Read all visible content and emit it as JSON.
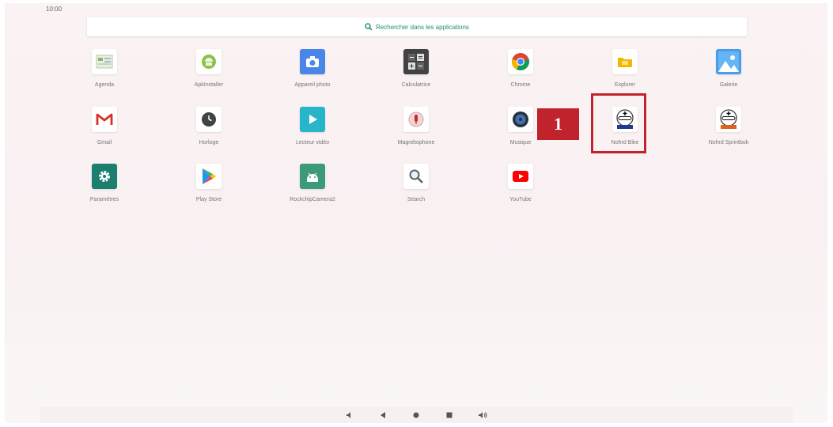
{
  "status_bar": {
    "time": "10:00"
  },
  "search": {
    "placeholder": "Rechercher dans les applications"
  },
  "apps": [
    {
      "label": "Agenda",
      "icon": "agenda-icon"
    },
    {
      "label": "ApkInstaller",
      "icon": "apkinstaller-icon"
    },
    {
      "label": "Appareil photo",
      "icon": "camera-icon"
    },
    {
      "label": "Calculatrice",
      "icon": "calculator-icon"
    },
    {
      "label": "Chrome",
      "icon": "chrome-icon"
    },
    {
      "label": "Explorer",
      "icon": "explorer-icon"
    },
    {
      "label": "Galerie",
      "icon": "gallery-icon"
    },
    {
      "label": "Gmail",
      "icon": "gmail-icon"
    },
    {
      "label": "Horloge",
      "icon": "clock-icon"
    },
    {
      "label": "Lecteur vidéo",
      "icon": "video-player-icon"
    },
    {
      "label": "Magnétophone",
      "icon": "recorder-icon"
    },
    {
      "label": "Musique",
      "icon": "music-icon"
    },
    {
      "label": "Nohrd Bike",
      "icon": "nohrd-bike-icon"
    },
    {
      "label": "Nohrd Sprintbok",
      "icon": "nohrd-sprintbok-icon"
    },
    {
      "label": "Paramètres",
      "icon": "settings-icon"
    },
    {
      "label": "Play Store",
      "icon": "play-store-icon"
    },
    {
      "label": "RockchipCamera2",
      "icon": "rockchip-camera-icon"
    },
    {
      "label": "Search",
      "icon": "search-app-icon"
    },
    {
      "label": "YouTube",
      "icon": "youtube-icon"
    }
  ],
  "callout": {
    "number": "1",
    "color": "#c0232b"
  },
  "navigation": [
    "volume-down-icon",
    "back-icon",
    "home-icon",
    "recents-icon",
    "volume-up-icon"
  ]
}
